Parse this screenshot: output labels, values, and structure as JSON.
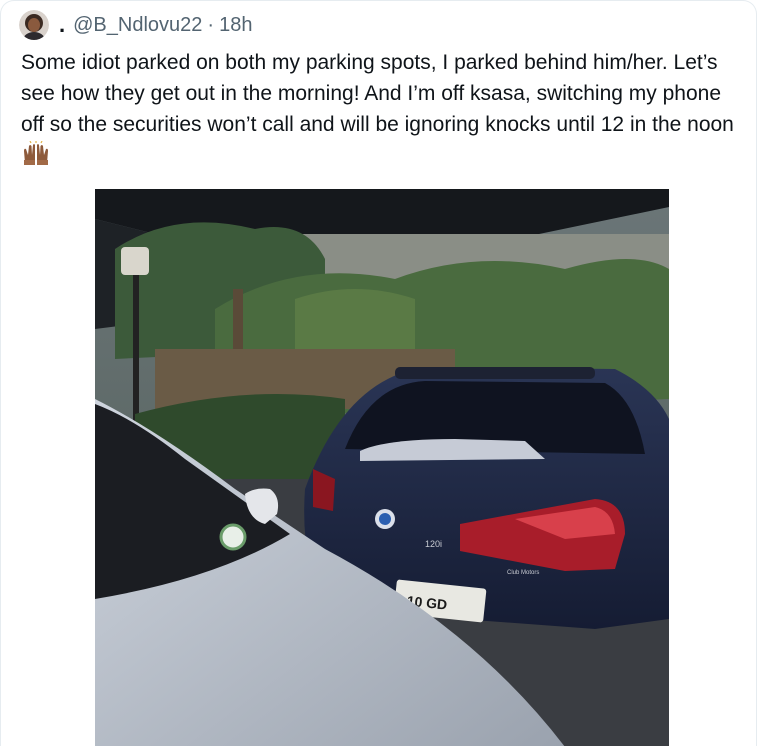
{
  "author": {
    "display_name": ".",
    "handle": "@B_Ndlovu22",
    "separator": "·",
    "time": "18h",
    "avatar_icon": "profile-avatar"
  },
  "tweet": {
    "text": "Some idiot parked on both my parking spots, I parked behind him/her. Let’s see how they get out in the morning! And I’m off ksasa, switching my phone off so the securities won’t call and will be ignoring knocks until 12 in the noon",
    "emoji_icon": "raising-hands-emoji"
  },
  "media": {
    "description_icon": "photo-parked-cars",
    "plate_text": "10 GD",
    "badge_text": "120i",
    "dealer_text": "Club Motors"
  }
}
